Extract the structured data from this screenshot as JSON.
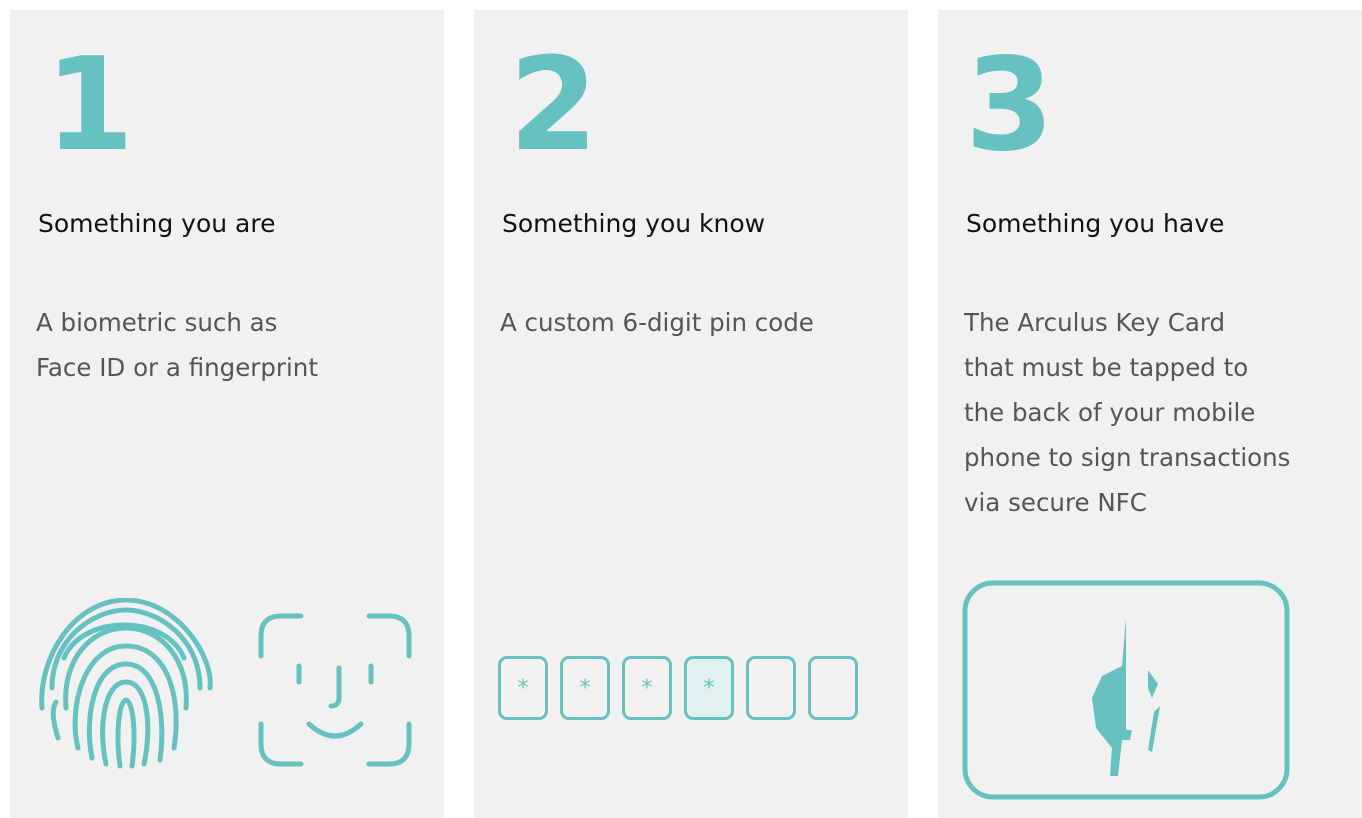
{
  "accent_color": "#66c2c0",
  "cards": [
    {
      "number": "1",
      "title": "Something you are",
      "description": [
        "A biometric such as",
        "Face ID or a fingerprint"
      ],
      "icons": [
        "fingerprint-icon",
        "face-id-icon"
      ]
    },
    {
      "number": "2",
      "title": "Something you know",
      "description": [
        "A custom 6-digit pin code"
      ],
      "pin": [
        "*",
        "*",
        "*",
        "*",
        "",
        ""
      ],
      "active_pin_index": 3
    },
    {
      "number": "3",
      "title": "Something you have",
      "description": [
        "The Arculus Key Card",
        "that must be tapped to",
        "the back of your mobile",
        "phone to sign transactions",
        "via secure NFC"
      ],
      "icons": [
        "arculus-key-card-icon"
      ]
    }
  ]
}
